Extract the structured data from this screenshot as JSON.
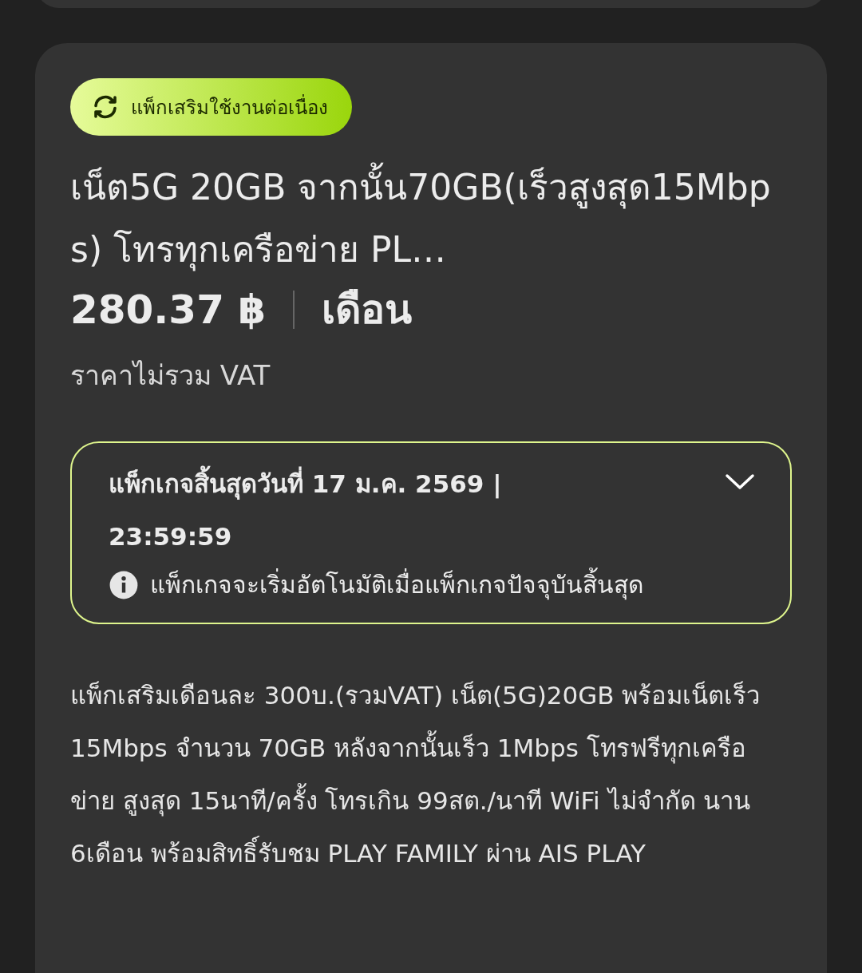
{
  "badge": {
    "label": "แพ็กเสริมใช้งานต่อเนื่อง"
  },
  "package": {
    "title": "เน็ต5G 20GB จากนั้น70GB(เร็วสูงสุด15Mbps) โทรทุกเครือข่าย PL…",
    "price": "280.37 ฿",
    "period": "เดือน",
    "price_note": "ราคาไม่รวม VAT"
  },
  "expiry": {
    "text": "แพ็กเกจสิ้นสุดวันที่ 17 ม.ค. 2569 | 23:59:59",
    "note": "แพ็กเกจจะเริ่มอัตโนมัติเมื่อแพ็กเกจปัจจุบันสิ้นสุด",
    "expanded": false
  },
  "description": "แพ็กเสริมเดือนละ 300บ.(รวมVAT) เน็ต(5G)20GB พร้อมเน็ตเร็ว 15Mbps จำนวน 70GB หลังจากนั้นเร็ว 1Mbps โทรฟรีทุกเครือข่าย สูงสุด 15นาที/ครั้ง โทรเกิน 99สต./นาที WiFi ไม่จำกัด นาน 6เดือน พร้อมสิทธิ์รับชม PLAY FAMILY ผ่าน AIS PLAY"
}
